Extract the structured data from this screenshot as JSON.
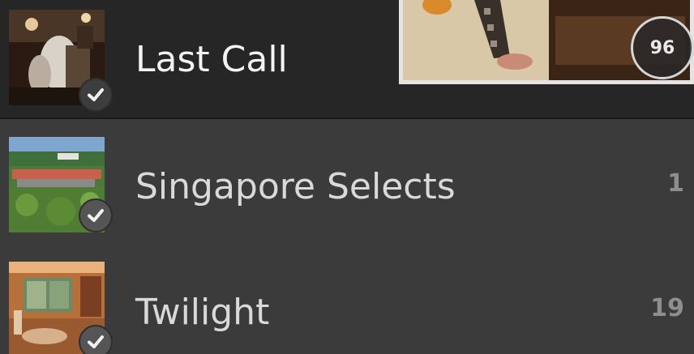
{
  "collections": [
    {
      "label": "Last Call",
      "count": "",
      "selected": true,
      "checked_icon": "checkmark-icon"
    },
    {
      "label": "Singapore Selects",
      "count": "1",
      "selected": false,
      "checked_icon": "checkmark-icon"
    },
    {
      "label": "Twilight",
      "count": "19",
      "selected": false,
      "checked_icon": "checkmark-icon"
    }
  ],
  "drag_preview": {
    "count_badge": "96"
  },
  "colors": {
    "selected_row_bg": "#262626",
    "row_bg": "#3b3b3b",
    "text_selected": "#f4f4f4",
    "text": "#d9d9d9",
    "count_text": "#8e8e8e"
  }
}
